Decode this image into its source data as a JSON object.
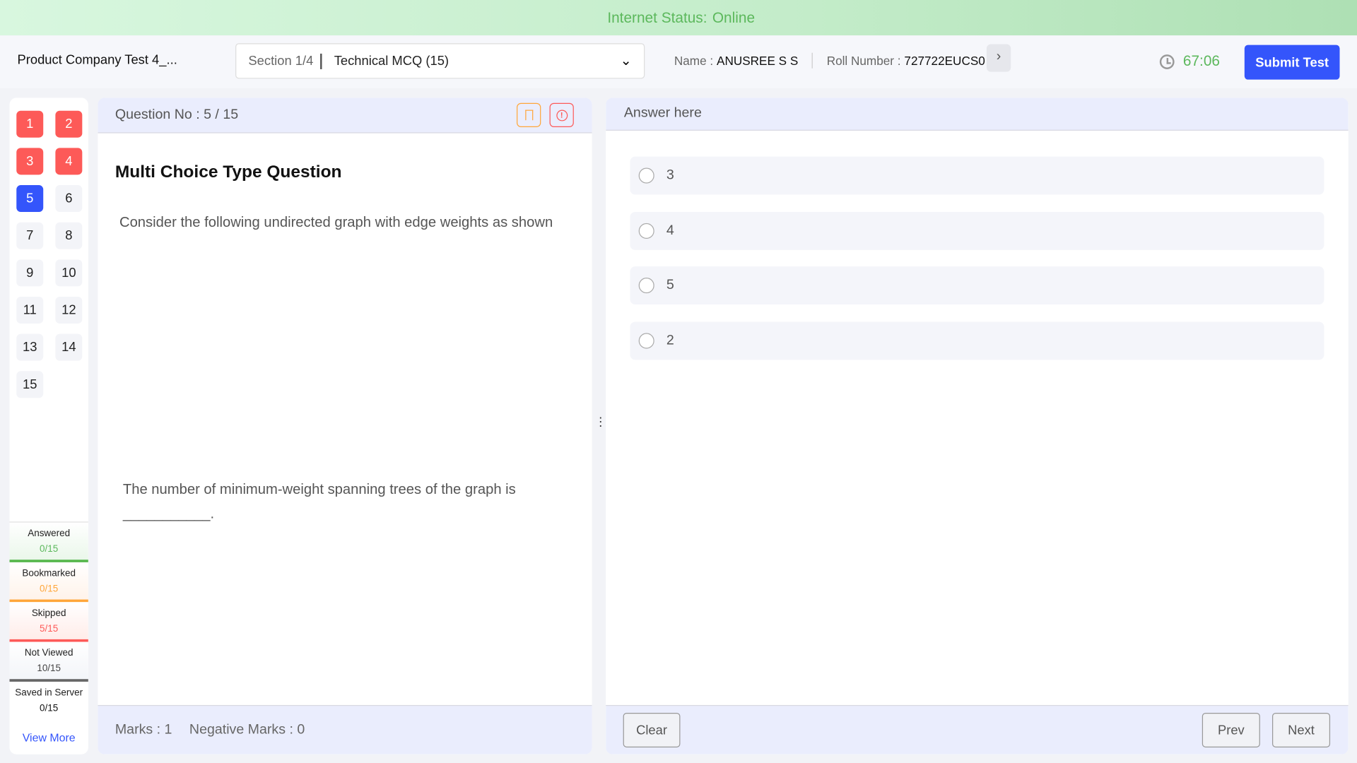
{
  "status": {
    "label": "Internet Status:",
    "value": "Online"
  },
  "header": {
    "test_title": "Product Company Test 4_...",
    "section_num": "Section 1/4",
    "section_name": "Technical MCQ (15)",
    "name_label": "Name :",
    "name_value": "ANUSREE S S",
    "roll_label": "Roll Number :",
    "roll_value": "727722EUCS0",
    "timer": "67:06",
    "submit": "Submit Test"
  },
  "palette": [
    {
      "n": "1",
      "state": "skipped"
    },
    {
      "n": "2",
      "state": "skipped"
    },
    {
      "n": "3",
      "state": "skipped"
    },
    {
      "n": "4",
      "state": "skipped"
    },
    {
      "n": "5",
      "state": "current"
    },
    {
      "n": "6",
      "state": "not-viewed"
    },
    {
      "n": "7",
      "state": "not-viewed"
    },
    {
      "n": "8",
      "state": "not-viewed"
    },
    {
      "n": "9",
      "state": "not-viewed"
    },
    {
      "n": "10",
      "state": "not-viewed"
    },
    {
      "n": "11",
      "state": "not-viewed"
    },
    {
      "n": "12",
      "state": "not-viewed"
    },
    {
      "n": "13",
      "state": "not-viewed"
    },
    {
      "n": "14",
      "state": "not-viewed"
    },
    {
      "n": "15",
      "state": "not-viewed"
    }
  ],
  "legend": {
    "answered": {
      "label": "Answered",
      "value": "0/15"
    },
    "bookmarked": {
      "label": "Bookmarked",
      "value": "0/15"
    },
    "skipped": {
      "label": "Skipped",
      "value": "5/15"
    },
    "not_viewed": {
      "label": "Not Viewed",
      "value": "10/15"
    },
    "saved": {
      "label": "Saved in Server",
      "value": "0/15"
    },
    "view_more": "View More"
  },
  "question": {
    "number": "Question No : 5 / 15",
    "type": "Multi Choice Type Question",
    "text": "Consider the following undirected graph with edge weights as shown",
    "text2": "The number of minimum-weight spanning trees of the graph is ___________.",
    "marks": "Marks : 1",
    "negative": "Negative Marks : 0"
  },
  "answer": {
    "title": "Answer here",
    "options": [
      "3",
      "4",
      "5",
      "2"
    ],
    "clear": "Clear",
    "prev": "Prev",
    "next": "Next"
  },
  "colors": {
    "accent": "#3455fb",
    "skipped": "#fd5a58",
    "answered": "#5cb85c",
    "bookmarked": "#ffa63a"
  }
}
